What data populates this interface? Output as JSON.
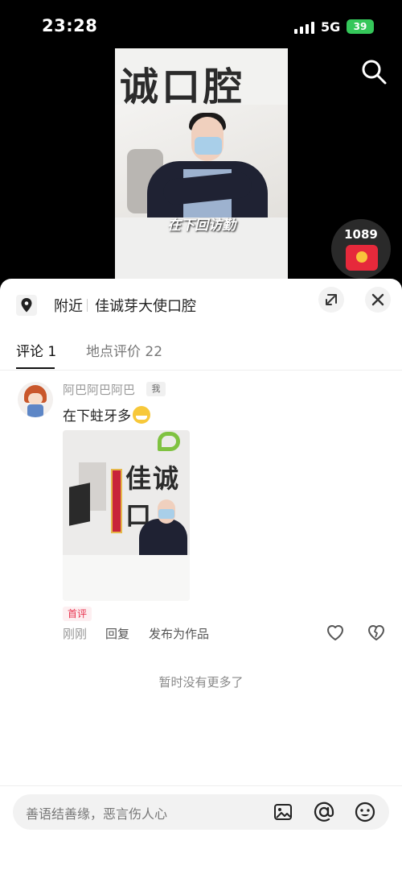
{
  "status_bar": {
    "time": "23:28",
    "network": "5G",
    "battery": "39"
  },
  "video": {
    "sign_text": "诚口腔",
    "caption": "在下回访勤"
  },
  "red_packet": {
    "count": "1089"
  },
  "location": {
    "label": "附近",
    "name": "佳诚芽大使口腔"
  },
  "tabs": [
    {
      "label": "评论 1"
    },
    {
      "label": "地点评价 22"
    }
  ],
  "comment": {
    "username": "阿巴阿巴阿巴",
    "me_badge": "我",
    "text": "在下蛀牙多",
    "image_sign": "佳诚口",
    "first_badge": "首评",
    "time": "刚刚",
    "reply_label": "回复",
    "publish_label": "发布为作品"
  },
  "no_more": "暂时没有更多了",
  "input": {
    "placeholder": "善语结善缘，恶言伤人心"
  },
  "colors": {
    "accent_red": "#e8344f",
    "battery_green": "#35c75a"
  }
}
